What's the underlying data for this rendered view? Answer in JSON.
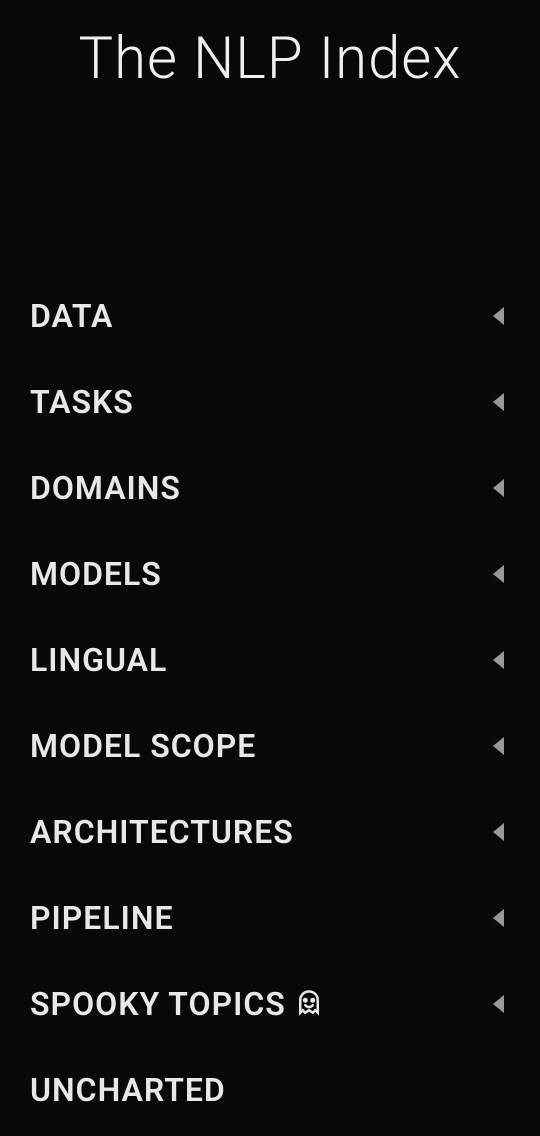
{
  "header": {
    "title": "The NLP Index"
  },
  "nav": {
    "items": [
      {
        "label": "DATA",
        "hasArrow": true,
        "hasGhost": false
      },
      {
        "label": "TASKS",
        "hasArrow": true,
        "hasGhost": false
      },
      {
        "label": "DOMAINS",
        "hasArrow": true,
        "hasGhost": false
      },
      {
        "label": "MODELS",
        "hasArrow": true,
        "hasGhost": false
      },
      {
        "label": "LINGUAL",
        "hasArrow": true,
        "hasGhost": false
      },
      {
        "label": "MODEL SCOPE",
        "hasArrow": true,
        "hasGhost": false
      },
      {
        "label": "ARCHITECTURES",
        "hasArrow": true,
        "hasGhost": false
      },
      {
        "label": "PIPELINE",
        "hasArrow": true,
        "hasGhost": false
      },
      {
        "label": "SPOOKY TOPICS",
        "hasArrow": true,
        "hasGhost": true
      },
      {
        "label": "UNCHARTED",
        "hasArrow": false,
        "hasGhost": false
      }
    ]
  }
}
